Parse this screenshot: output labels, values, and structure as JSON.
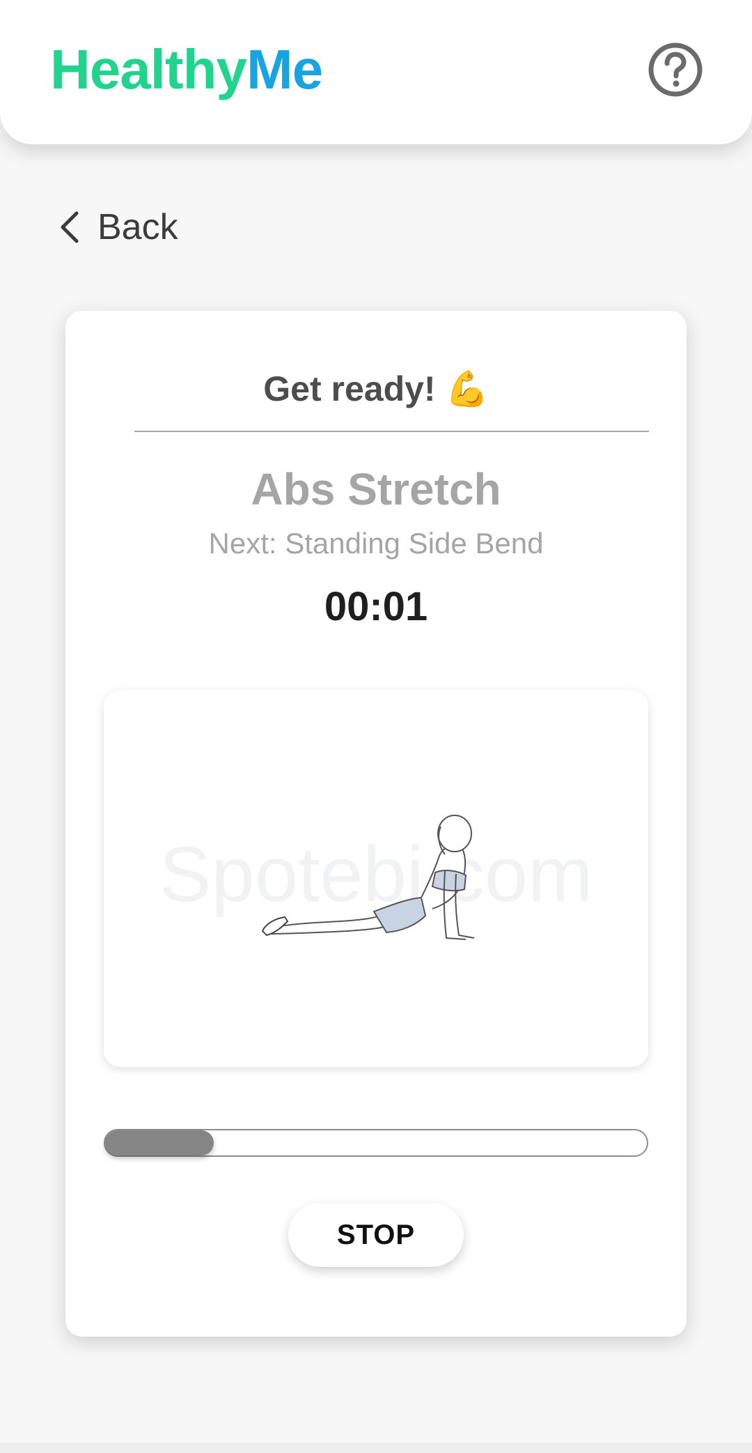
{
  "app": {
    "name_part1": "Healthy",
    "name_part2": "Me",
    "brand_colors": {
      "healthy": "#22d38e",
      "me": "#16a5e1"
    },
    "help_icon": "question-circle-icon"
  },
  "nav": {
    "back_label": "Back",
    "back_icon": "chevron-left-icon"
  },
  "workout": {
    "status_title": "Get ready!",
    "status_emoji": "💪",
    "exercise_name": "Abs Stretch",
    "next_text": "Next: Standing Side Bend",
    "timer": "00:01",
    "image_watermark": "Spotebi.com",
    "image_subject": "cobra-stretch-illustration",
    "progress_fraction": 0.2,
    "stop_label": "STOP"
  }
}
